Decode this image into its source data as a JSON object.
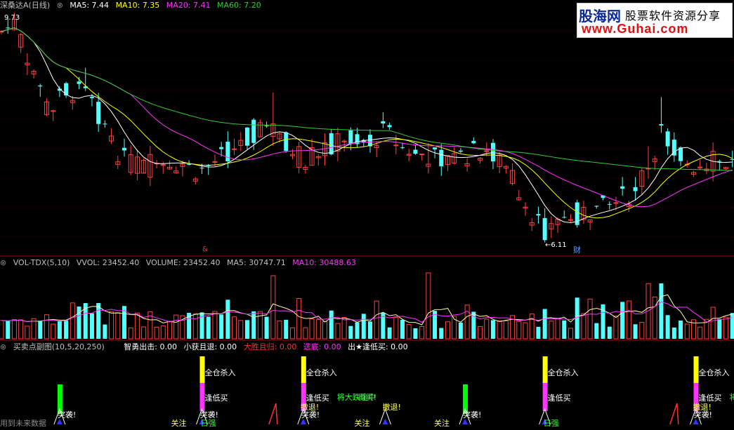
{
  "price_panel": {
    "stock_name": "深桑达A",
    "period": "(日线)",
    "ma_labels": [
      {
        "label": "MA5: 7.44",
        "color": "#ffffff"
      },
      {
        "label": "MA10: 7.35",
        "color": "#ffff00"
      },
      {
        "label": "MA20: 7.41",
        "color": "#ff33ff"
      },
      {
        "label": "MA60: 7.20",
        "color": "#33cc33"
      }
    ],
    "high_marker": "9.73",
    "low_marker": "←6.11",
    "tag_left": "&",
    "tag_caizi": "财"
  },
  "watermark": {
    "logo": "股海网",
    "slogan": "股票软件资源分享",
    "url": "www.Guhai.com"
  },
  "volume_panel": {
    "labels": [
      {
        "label": "VOL-TDX(5,10)",
        "color": "#c0c0c0"
      },
      {
        "label": "VVOL: 23452.40",
        "color": "#c0c0c0"
      },
      {
        "label": "VOLUME: 23452.40",
        "color": "#c0c0c0"
      },
      {
        "label": "MA5: 30747.71",
        "color": "#c0c0c0"
      },
      {
        "label": "MA10: 30488.63",
        "color": "#ff33ff"
      }
    ]
  },
  "signal_panel": {
    "labels": [
      {
        "label": "买卖点副图(10,5,20,250)",
        "color": "#c0c0c0"
      },
      {
        "label": "智勇出击: 0.00",
        "color": "#ffffff"
      },
      {
        "label": "小获且退: 0.00",
        "color": "#ffffff"
      },
      {
        "label": "大胜且归: 0.00",
        "color": "#ff3333"
      },
      {
        "label": "选底: 0.00",
        "color": "#ff33ff"
      },
      {
        "label": "出★逢低买: 0.00",
        "color": "#ffffff"
      }
    ],
    "footer_note": "用到未来数据",
    "colors": {
      "full_kill": "#ffff00",
      "low_buy": "#ff33ff",
      "attack": "#00ff00",
      "text_white": "#ffffff",
      "text_yellow": "#ffff66",
      "text_green": "#33ff33"
    },
    "signals": [
      {
        "bar": 27,
        "type": "attack",
        "texts": [
          "突袭!"
        ]
      },
      {
        "bar": 93,
        "type": "full",
        "texts": [
          "全仓杀入",
          "逢低买",
          "突袭!",
          "关注",
          "日强"
        ]
      },
      {
        "bar": 140,
        "type": "full",
        "texts": [
          "全仓杀入",
          "逢低买",
          "撤退!",
          "将大跌途中",
          "再买!",
          "突袭!"
        ]
      },
      {
        "bar": 178,
        "type": "watch",
        "texts": [
          "撤退!",
          "关注"
        ]
      },
      {
        "bar": 215,
        "type": "attack",
        "texts": [
          "突袭!",
          "关注"
        ]
      },
      {
        "bar": 252,
        "type": "full",
        "texts": [
          "全仓杀入",
          "逢低买",
          "日强"
        ]
      },
      {
        "bar": 322,
        "type": "full",
        "texts": [
          "全仓杀入",
          "逢低买",
          "撤退!",
          "将大跌",
          "完再",
          "突袭!"
        ]
      }
    ]
  },
  "chart_data": {
    "type": "candlestick",
    "y_high_label": 9.73,
    "y_low_label": 6.11,
    "ma_periods": [
      5,
      10,
      20,
      60
    ],
    "notes": "daily K-line with volume and signal sub-panels"
  }
}
